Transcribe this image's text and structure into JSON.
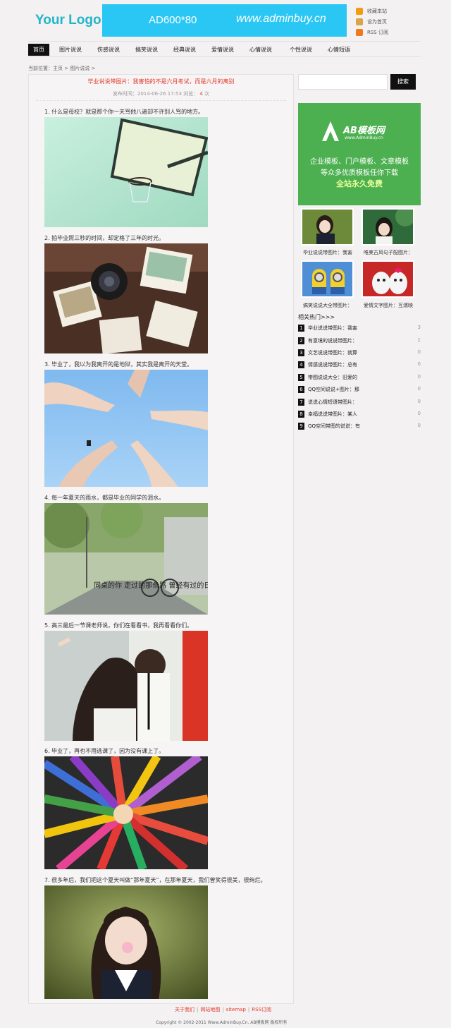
{
  "header": {
    "logo": "Your Logo",
    "ad_left": "AD600*80",
    "ad_right": "www.adminbuy.cn",
    "links": [
      {
        "label": "收藏本站",
        "color": "#f39c12"
      },
      {
        "label": "设为首页",
        "color": "#f0b050"
      },
      {
        "label": "RSS 订阅",
        "color": "#f07a1a"
      }
    ]
  },
  "nav": {
    "items": [
      "首页",
      "图片说说",
      "伤感说说",
      "搞笑说说",
      "经典说说",
      "爱情说说",
      "心情说说",
      "个性说说",
      "心情短语"
    ]
  },
  "breadcrumb": {
    "prefix": "当前位置：",
    "home": "主页",
    "sep1": ">",
    "category": "图片说说",
    "sep2": ">"
  },
  "article": {
    "title": "毕业说说带图片：我害怕的不是六月考试，而是六月的离别",
    "meta_prefix": "发布时间：2014-06-26 17:53 浏览：",
    "views": "4",
    "meta_suffix": "次",
    "paragraphs": [
      "1. 什么是母校？就是那个你一天骂他八遍却不许别人骂的地方。",
      "2. 拍毕业照三秒的时间，却定格了三年的时光。",
      "3. 毕业了，我以为我离开的是地狱，其实我是离开的天堂。",
      "4. 每一年夏天的雨水，都是毕业的同学的泪水。",
      "5. 高三最后一节课老师说，你们在看看书，我再看看你们。",
      "6. 毕业了，再也不用逃课了，因为没有课上了。",
      "7. 很多年后，我们把这个夏天叫做“那年夏天”，在那年夏天，我们曾笑得很美，很绚烂。"
    ],
    "photo4_caption": "同桌的你 走过的那条路 曾经有过的日子"
  },
  "sidebar": {
    "search_button": "搜索",
    "ad_brand": "AB模板网",
    "ad_domain": "www.AdminBuy.cn",
    "ad_line1": "企业模板、门户模板、文章模板",
    "ad_line2": "等众多优质模板任你下载",
    "ad_line3": "全站永久免费",
    "thumbs": [
      "毕业说说带图片：我害",
      "唯美古风句子配图片：",
      "搞笑说说大全带图片：",
      "爱情文字图片：互濡映"
    ],
    "hot_title": "相关热门>>>",
    "hot": [
      {
        "n": "1",
        "t": "毕业说说带图片：我害",
        "c": "3"
      },
      {
        "n": "2",
        "t": "有意境的说说带图片：",
        "c": "1"
      },
      {
        "n": "3",
        "t": "文艺说说带图片：就算",
        "c": "0"
      },
      {
        "n": "4",
        "t": "情感说说带图片：总有",
        "c": "0"
      },
      {
        "n": "5",
        "t": "带图说说大全：旧爱的",
        "c": "0"
      },
      {
        "n": "6",
        "t": "QQ空间说说+图片：那",
        "c": "0"
      },
      {
        "n": "7",
        "t": "说说心情短语带图片：",
        "c": "0"
      },
      {
        "n": "8",
        "t": "幸福说说带图片：某人",
        "c": "0"
      },
      {
        "n": "9",
        "t": "QQ空间带图的说说：有",
        "c": "0"
      }
    ]
  },
  "footer": {
    "links": [
      "关于我们",
      "网站地图",
      "sitemap",
      "RSS订阅"
    ],
    "copyright": "Copyright © 2002-2011 Www.AdminBuy.Cn. AB模板网 版权所有"
  }
}
